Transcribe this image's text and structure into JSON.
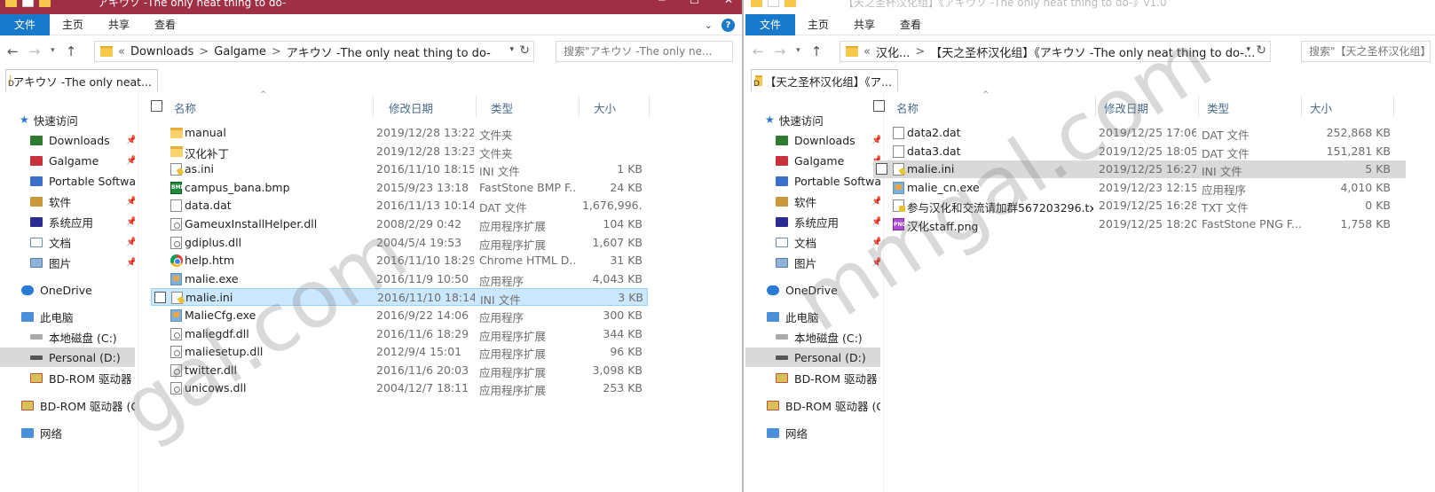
{
  "w1": {
    "title": "アキウソ -The only neat thing to do-",
    "ribbon": {
      "file": "文件",
      "home": "主页",
      "share": "共享",
      "view": "查看"
    },
    "address": [
      "«",
      "Downloads",
      ">",
      "Galgame",
      ">",
      "アキウソ -The only neat thing to do-"
    ],
    "search_placeholder": "搜索\"アキウソ -The only ne...",
    "folder_tab": "アキウソ -The only neat...",
    "nav": {
      "quick": "快速访问",
      "downloads": "Downloads",
      "galgame": "Galgame",
      "portable": "Portable Softwa",
      "software": "软件",
      "sysapps": "系统应用",
      "docs": "文档",
      "pics": "图片",
      "onedrive": "OneDrive",
      "thispc": "此电脑",
      "localc": "本地磁盘 (C:)",
      "personal": "Personal (D:)",
      "bdrom1": "BD-ROM 驱动器 (",
      "bdrom2": "BD-ROM 驱动器 (G:",
      "network": "网络"
    },
    "columns": {
      "name": "名称",
      "date": "修改日期",
      "type": "类型",
      "size": "大小"
    },
    "files": [
      {
        "name": "manual",
        "date": "2019/12/28 13:22",
        "type": "文件夹",
        "size": "",
        "icon": "folder-icon"
      },
      {
        "name": "汉化补丁",
        "date": "2019/12/28 13:23",
        "type": "文件夹",
        "size": "",
        "icon": "folder-icon"
      },
      {
        "name": "as.ini",
        "date": "2016/11/10 18:15",
        "type": "INI 文件",
        "size": "1 KB",
        "icon": "ini-file-icon"
      },
      {
        "name": "campus_bana.bmp",
        "date": "2015/9/23 13:18",
        "type": "FastStone BMP F...",
        "size": "24 KB",
        "icon": "bmp-file-icon"
      },
      {
        "name": "data.dat",
        "date": "2016/11/13 10:14",
        "type": "DAT 文件",
        "size": "1,676,996...",
        "icon": "dat-file-icon"
      },
      {
        "name": "GameuxInstallHelper.dll",
        "date": "2008/2/29 0:42",
        "type": "应用程序扩展",
        "size": "104 KB",
        "icon": "dll-file-icon"
      },
      {
        "name": "gdiplus.dll",
        "date": "2004/5/4 19:53",
        "type": "应用程序扩展",
        "size": "1,607 KB",
        "icon": "dll-file-icon"
      },
      {
        "name": "help.htm",
        "date": "2016/11/10 18:29",
        "type": "Chrome HTML D...",
        "size": "31 KB",
        "icon": "chrome-html-icon"
      },
      {
        "name": "malie.exe",
        "date": "2016/11/9 10:50",
        "type": "应用程序",
        "size": "4,043 KB",
        "icon": "exe-file-icon"
      },
      {
        "name": "malie.ini",
        "date": "2016/11/10 18:14",
        "type": "INI 文件",
        "size": "3 KB",
        "icon": "ini-file-icon",
        "selected": true
      },
      {
        "name": "MalieCfg.exe",
        "date": "2016/9/22 14:06",
        "type": "应用程序",
        "size": "300 KB",
        "icon": "exe-file-icon"
      },
      {
        "name": "maliegdf.dll",
        "date": "2016/11/6 18:29",
        "type": "应用程序扩展",
        "size": "344 KB",
        "icon": "dll-file-icon"
      },
      {
        "name": "maliesetup.dll",
        "date": "2012/9/4 15:01",
        "type": "应用程序扩展",
        "size": "96 KB",
        "icon": "dll-file-icon"
      },
      {
        "name": "twitter.dll",
        "date": "2016/11/6 20:03",
        "type": "应用程序扩展",
        "size": "3,098 KB",
        "icon": "dll-file-icon"
      },
      {
        "name": "unicows.dll",
        "date": "2004/12/7 18:11",
        "type": "应用程序扩展",
        "size": "253 KB",
        "icon": "dll-file-icon"
      }
    ]
  },
  "w2": {
    "title": "【天之圣杯汉化组】《アキウソ -The only neat thing to do-》v1.0",
    "ribbon": {
      "file": "文件",
      "home": "主页",
      "share": "共享",
      "view": "查看"
    },
    "address": [
      "«",
      "汉化...",
      ">",
      "【天之圣杯汉化组】《アキウソ -The only neat thing to do-..."
    ],
    "search_placeholder": "搜索\"【天之圣杯汉化组】...",
    "folder_tab": "【天之圣杯汉化组】《ア...",
    "nav": {
      "quick": "快速访问",
      "downloads": "Downloads",
      "galgame": "Galgame",
      "portable": "Portable Softwa",
      "software": "软件",
      "sysapps": "系统应用",
      "docs": "文档",
      "pics": "图片",
      "onedrive": "OneDrive",
      "thispc": "此电脑",
      "localc": "本地磁盘 (C:)",
      "personal": "Personal (D:)",
      "bdrom1": "BD-ROM 驱动器 (",
      "bdrom2": "BD-ROM 驱动器 (G:",
      "network": "网络"
    },
    "columns": {
      "name": "名称",
      "date": "修改日期",
      "type": "类型",
      "size": "大小"
    },
    "files": [
      {
        "name": "data2.dat",
        "date": "2019/12/25 17:06",
        "type": "DAT 文件",
        "size": "252,868 KB",
        "icon": "dat-file-icon"
      },
      {
        "name": "data3.dat",
        "date": "2019/12/25 18:05",
        "type": "DAT 文件",
        "size": "151,281 KB",
        "icon": "dat-file-icon"
      },
      {
        "name": "malie.ini",
        "date": "2019/12/25 16:27",
        "type": "INI 文件",
        "size": "5 KB",
        "icon": "ini-file-icon",
        "selected": true
      },
      {
        "name": "malie_cn.exe",
        "date": "2019/12/23 12:15",
        "type": "应用程序",
        "size": "4,010 KB",
        "icon": "exe-file-icon"
      },
      {
        "name": "参与汉化和交流请加群567203296.txt",
        "date": "2019/12/25 16:28",
        "type": "TXT 文件",
        "size": "0 KB",
        "icon": "txt-file-icon"
      },
      {
        "name": "汉化staff.png",
        "date": "2019/12/25 18:20",
        "type": "FastStone PNG F...",
        "size": "1,758 KB",
        "icon": "png-file-icon"
      }
    ]
  },
  "watermark": {
    "left": "gal.com",
    "right": "mmgal.com"
  },
  "colors": {
    "title_active": "#9f2f45",
    "file_tab": "#1979ca",
    "selection": "#cce8ff",
    "inactive_selection": "#d9d9d9"
  }
}
